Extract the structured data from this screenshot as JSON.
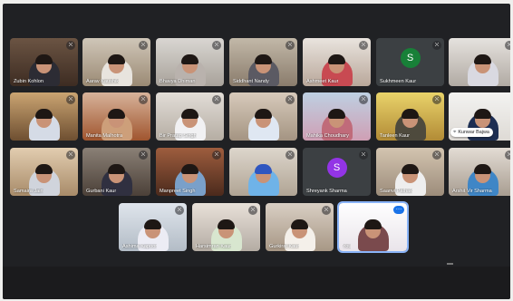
{
  "meeting": {
    "tiles": [
      {
        "name": "Zubin Kohlon",
        "muted": true
      },
      {
        "name": "Aarav Kaushik",
        "muted": true
      },
      {
        "name": "Bhavya Dhiman",
        "muted": true
      },
      {
        "name": "Siddhant Nandy",
        "muted": true
      },
      {
        "name": "Ashmeet Kaur",
        "muted": true
      },
      {
        "name": "Sukhmeen Kaur",
        "muted": true,
        "avatar_letter": "S",
        "avatar_color": "#188038"
      },
      {
        "name": "",
        "muted": true
      },
      {
        "name": "",
        "muted": true
      },
      {
        "name": "Manita Malhotra",
        "muted": true
      },
      {
        "name": "Bir Pratap Singh",
        "muted": true
      },
      {
        "name": "",
        "muted": true
      },
      {
        "name": "Mahika Choudhary",
        "muted": true
      },
      {
        "name": "Tanleen Kaur",
        "muted": true
      },
      {
        "name": "",
        "muted": false
      },
      {
        "name": "Samaira Jain",
        "muted": true
      },
      {
        "name": "Gurbani Kaur",
        "muted": true
      },
      {
        "name": "Manpreet Singh",
        "muted": true
      },
      {
        "name": "",
        "muted": true
      },
      {
        "name": "Shreyank Sharma",
        "muted": true,
        "avatar_letter": "S",
        "avatar_color": "#9334e6"
      },
      {
        "name": "Saanvi Pathak",
        "muted": true
      },
      {
        "name": "Arshit Vir Sharma",
        "muted": true
      },
      {
        "name": "Ashima Kapoor",
        "muted": true
      },
      {
        "name": "Harsimran Kaur",
        "muted": true
      },
      {
        "name": "Gurkirat Kaur",
        "muted": true
      },
      {
        "name": "You",
        "muted": false,
        "is_self": true
      }
    ],
    "pinned_chip": {
      "label": "Kunwar Bajwa"
    },
    "colors": {
      "self_border": "#8ab4f8",
      "stage_bg": "#202124"
    }
  }
}
